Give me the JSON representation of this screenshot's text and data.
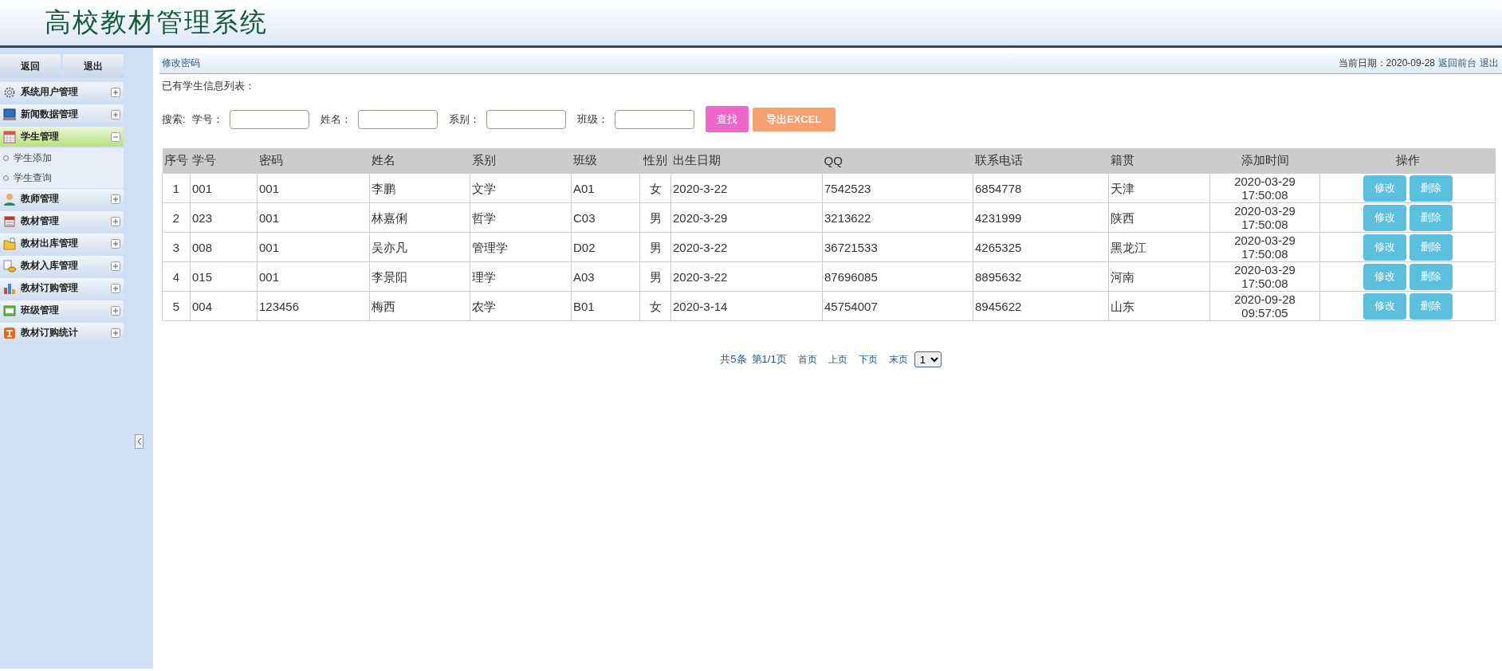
{
  "header": {
    "title": "高校教材管理系统"
  },
  "sidebar": {
    "buttons": [
      "返回",
      "退出"
    ],
    "items": [
      {
        "label": "系统用户管理",
        "expanded": false
      },
      {
        "label": "新闻数据管理",
        "expanded": false
      },
      {
        "label": "学生管理",
        "expanded": true,
        "children": [
          {
            "label": "学生添加"
          },
          {
            "label": "学生查询"
          }
        ]
      },
      {
        "label": "教师管理",
        "expanded": false
      },
      {
        "label": "教材管理",
        "expanded": false
      },
      {
        "label": "教材出库管理",
        "expanded": false
      },
      {
        "label": "教材入库管理",
        "expanded": false
      },
      {
        "label": "教材订购管理",
        "expanded": false
      },
      {
        "label": "班级管理",
        "expanded": false
      },
      {
        "label": "教材订购统计",
        "expanded": false
      }
    ]
  },
  "topbar": {
    "link": "修改密码",
    "date_label": "当前日期：2020-09-28",
    "links": [
      "返回前台",
      "退出"
    ]
  },
  "list_title": "已有学生信息列表：",
  "search": {
    "prefix": "搜索:",
    "fields": [
      {
        "label": "学号："
      },
      {
        "label": "姓名："
      },
      {
        "label": "系别："
      },
      {
        "label": "班级："
      }
    ],
    "buttons": [
      {
        "label": "查找",
        "kind": "search"
      },
      {
        "label": "导出EXCEL",
        "kind": "export"
      }
    ]
  },
  "table": {
    "columns": [
      "序号",
      "学号",
      "密码",
      "姓名",
      "系别",
      "班级",
      "性别",
      "出生日期",
      "QQ",
      "联系电话",
      "籍贯",
      "添加时间",
      "操作"
    ],
    "rows": [
      {
        "cells": [
          "1",
          "001",
          "001",
          "李鹏",
          "文学",
          "A01",
          "女",
          "2020-3-22",
          "7542523",
          "6854778",
          "天津"
        ],
        "added": [
          "2020-03-29",
          "17:50:08"
        ],
        "actions": [
          "修改",
          "删除"
        ]
      },
      {
        "cells": [
          "2",
          "023",
          "001",
          "林嘉俐",
          "哲学",
          "C03",
          "男",
          "2020-3-29",
          "3213622",
          "4231999",
          "陕西"
        ],
        "added": [
          "2020-03-29",
          "17:50:08"
        ],
        "actions": [
          "修改",
          "删除"
        ]
      },
      {
        "cells": [
          "3",
          "008",
          "001",
          "吴亦凡",
          "管理学",
          "D02",
          "男",
          "2020-3-22",
          "36721533",
          "4265325",
          "黑龙江"
        ],
        "added": [
          "2020-03-29",
          "17:50:08"
        ],
        "actions": [
          "修改",
          "删除"
        ]
      },
      {
        "cells": [
          "4",
          "015",
          "001",
          "李景阳",
          "理学",
          "A03",
          "男",
          "2020-3-22",
          "87696085",
          "8895632",
          "河南"
        ],
        "added": [
          "2020-03-29",
          "17:50:08"
        ],
        "actions": [
          "修改",
          "删除"
        ]
      },
      {
        "cells": [
          "5",
          "004",
          "123456",
          "梅西",
          "农学",
          "B01",
          "女",
          "2020-3-14",
          "45754007",
          "8945622",
          "山东"
        ],
        "added": [
          "2020-09-28",
          "09:57:05"
        ],
        "actions": [
          "修改",
          "删除"
        ]
      }
    ]
  },
  "pagination": {
    "summary": [
      "共5条",
      "第1/1页"
    ],
    "links": [
      "首页",
      "上页",
      "下页",
      "末页"
    ],
    "page": "1"
  }
}
